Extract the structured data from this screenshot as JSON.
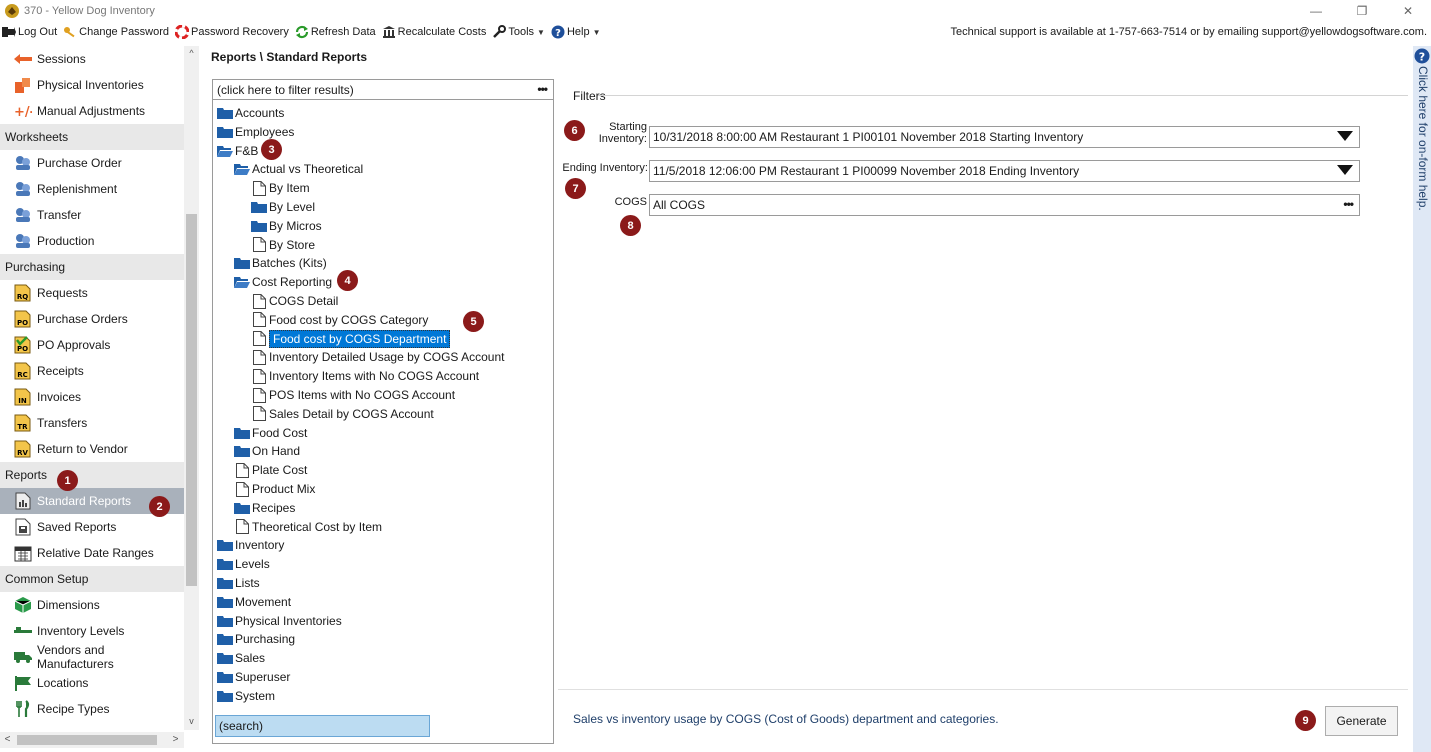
{
  "window": {
    "title": "370 - Yellow Dog Inventory",
    "controls": [
      "—",
      "❐",
      "✕"
    ]
  },
  "toolbar": {
    "items": [
      {
        "label": "Log Out",
        "icon": "logout-icon"
      },
      {
        "label": "Change Password",
        "icon": "key-icon"
      },
      {
        "label": "Password Recovery",
        "icon": "lifebuoy-icon"
      },
      {
        "label": "Refresh Data",
        "icon": "refresh-icon"
      },
      {
        "label": "Recalculate Costs",
        "icon": "bank-icon"
      },
      {
        "label": "Tools",
        "icon": "wrench-icon",
        "dropdown": true
      },
      {
        "label": "Help",
        "icon": "help-icon",
        "dropdown": true
      }
    ],
    "support_text": "Technical support is available at 1-757-663-7514 or by emailing support@yellowdogsoftware.com."
  },
  "leftnav": {
    "entries": [
      {
        "kind": "item",
        "label": "Sessions",
        "icon": "arrow-icon"
      },
      {
        "kind": "item",
        "label": "Physical Inventories",
        "icon": "boxes-icon"
      },
      {
        "kind": "item",
        "label": "Manual Adjustments",
        "icon": "plus-minus-icon"
      },
      {
        "kind": "group",
        "label": "Worksheets"
      },
      {
        "kind": "item",
        "label": "Purchase Order",
        "icon": "people-icon"
      },
      {
        "kind": "item",
        "label": "Replenishment",
        "icon": "people-icon"
      },
      {
        "kind": "item",
        "label": "Transfer",
        "icon": "people-icon"
      },
      {
        "kind": "item",
        "label": "Production",
        "icon": "people-icon"
      },
      {
        "kind": "group",
        "label": "Purchasing"
      },
      {
        "kind": "item",
        "label": "Requests",
        "icon": "doc-rq-icon",
        "code": "RQ"
      },
      {
        "kind": "item",
        "label": "Purchase Orders",
        "icon": "doc-po-icon",
        "code": "PO"
      },
      {
        "kind": "item",
        "label": "PO Approvals",
        "icon": "doc-po-check-icon",
        "code": "PO"
      },
      {
        "kind": "item",
        "label": "Receipts",
        "icon": "doc-rc-icon",
        "code": "RC"
      },
      {
        "kind": "item",
        "label": "Invoices",
        "icon": "doc-in-icon",
        "code": "IN"
      },
      {
        "kind": "item",
        "label": "Transfers",
        "icon": "doc-tr-icon",
        "code": "TR"
      },
      {
        "kind": "item",
        "label": "Return to Vendor",
        "icon": "doc-rv-icon",
        "code": "RV"
      },
      {
        "kind": "group",
        "label": "Reports"
      },
      {
        "kind": "item",
        "label": "Standard Reports",
        "icon": "report-icon",
        "selected": true
      },
      {
        "kind": "item",
        "label": "Saved Reports",
        "icon": "saved-report-icon"
      },
      {
        "kind": "item",
        "label": "Relative Date Ranges",
        "icon": "calendar-icon"
      },
      {
        "kind": "group",
        "label": "Common Setup"
      },
      {
        "kind": "item",
        "label": "Dimensions",
        "icon": "cube-icon"
      },
      {
        "kind": "item",
        "label": "Inventory Levels",
        "icon": "levels-icon"
      },
      {
        "kind": "item",
        "label": "Vendors and Manufacturers",
        "icon": "truck-icon"
      },
      {
        "kind": "item",
        "label": "Locations",
        "icon": "flag-icon"
      },
      {
        "kind": "item",
        "label": "Recipe Types",
        "icon": "utensils-icon"
      }
    ]
  },
  "breadcrumb": "Reports \\ Standard Reports",
  "tree": {
    "filter_placeholder": "(click here to filter results)",
    "filter_button": "•••",
    "search_text": "(search)",
    "rows": [
      {
        "label": "Accounts",
        "type": "folder",
        "depth": 0
      },
      {
        "label": "Employees",
        "type": "folder",
        "depth": 0
      },
      {
        "label": "F&B",
        "type": "folder-open",
        "depth": 0
      },
      {
        "label": "Actual vs Theoretical",
        "type": "folder-open",
        "depth": 1
      },
      {
        "label": "By Item",
        "type": "doc",
        "depth": 2
      },
      {
        "label": "By Level",
        "type": "folder",
        "depth": 2
      },
      {
        "label": "By Micros",
        "type": "folder",
        "depth": 2
      },
      {
        "label": "By Store",
        "type": "doc",
        "depth": 2
      },
      {
        "label": "Batches (Kits)",
        "type": "folder",
        "depth": 1
      },
      {
        "label": "Cost Reporting",
        "type": "folder-open",
        "depth": 1
      },
      {
        "label": "COGS Detail",
        "type": "doc",
        "depth": 2
      },
      {
        "label": "Food cost by COGS Category",
        "type": "doc",
        "depth": 2
      },
      {
        "label": "Food cost by COGS Department",
        "type": "doc",
        "depth": 2,
        "selected": true
      },
      {
        "label": "Inventory Detailed Usage by COGS Account",
        "type": "doc",
        "depth": 2
      },
      {
        "label": "Inventory Items with No COGS Account",
        "type": "doc",
        "depth": 2
      },
      {
        "label": "POS Items with No COGS Account",
        "type": "doc",
        "depth": 2
      },
      {
        "label": "Sales Detail by COGS Account",
        "type": "doc",
        "depth": 2
      },
      {
        "label": "Food Cost",
        "type": "folder",
        "depth": 1
      },
      {
        "label": "On Hand",
        "type": "folder",
        "depth": 1
      },
      {
        "label": "Plate Cost",
        "type": "doc",
        "depth": 1
      },
      {
        "label": "Product Mix",
        "type": "doc",
        "depth": 1
      },
      {
        "label": "Recipes",
        "type": "folder",
        "depth": 1
      },
      {
        "label": "Theoretical Cost by Item",
        "type": "doc",
        "depth": 1
      },
      {
        "label": "Inventory",
        "type": "folder",
        "depth": 0
      },
      {
        "label": "Levels",
        "type": "folder",
        "depth": 0
      },
      {
        "label": "Lists",
        "type": "folder",
        "depth": 0
      },
      {
        "label": "Movement",
        "type": "folder",
        "depth": 0
      },
      {
        "label": "Physical Inventories",
        "type": "folder",
        "depth": 0
      },
      {
        "label": "Purchasing",
        "type": "folder",
        "depth": 0
      },
      {
        "label": "Sales",
        "type": "folder",
        "depth": 0
      },
      {
        "label": "Superuser",
        "type": "folder",
        "depth": 0
      },
      {
        "label": "System",
        "type": "folder",
        "depth": 0
      }
    ]
  },
  "filters": {
    "heading": "Filters",
    "starting_label": "Starting\nInventory:",
    "starting_value": "10/31/2018 8:00:00 AM Restaurant 1 PI00101 November 2018 Starting Inventory",
    "ending_label": "Ending Inventory:",
    "ending_value": "11/5/2018 12:06:00 PM Restaurant 1 PI00099 November 2018 Ending Inventory",
    "cogs_label": "COGS",
    "cogs_value": "All COGS",
    "cogs_button": "•••"
  },
  "description": "Sales vs inventory usage by COGS (Cost of Goods) department and categories.",
  "generate_label": "Generate",
  "help_text": "Click here for on-form help.",
  "badges": [
    "1",
    "2",
    "3",
    "4",
    "5",
    "6",
    "7",
    "8",
    "9"
  ],
  "colors": {
    "badge": "#8b1a1a",
    "selection": "#0078d7",
    "nav_selected": "#a9b1bb",
    "folder": "#1f5fa8",
    "help_strip": "#dfe8f5"
  }
}
